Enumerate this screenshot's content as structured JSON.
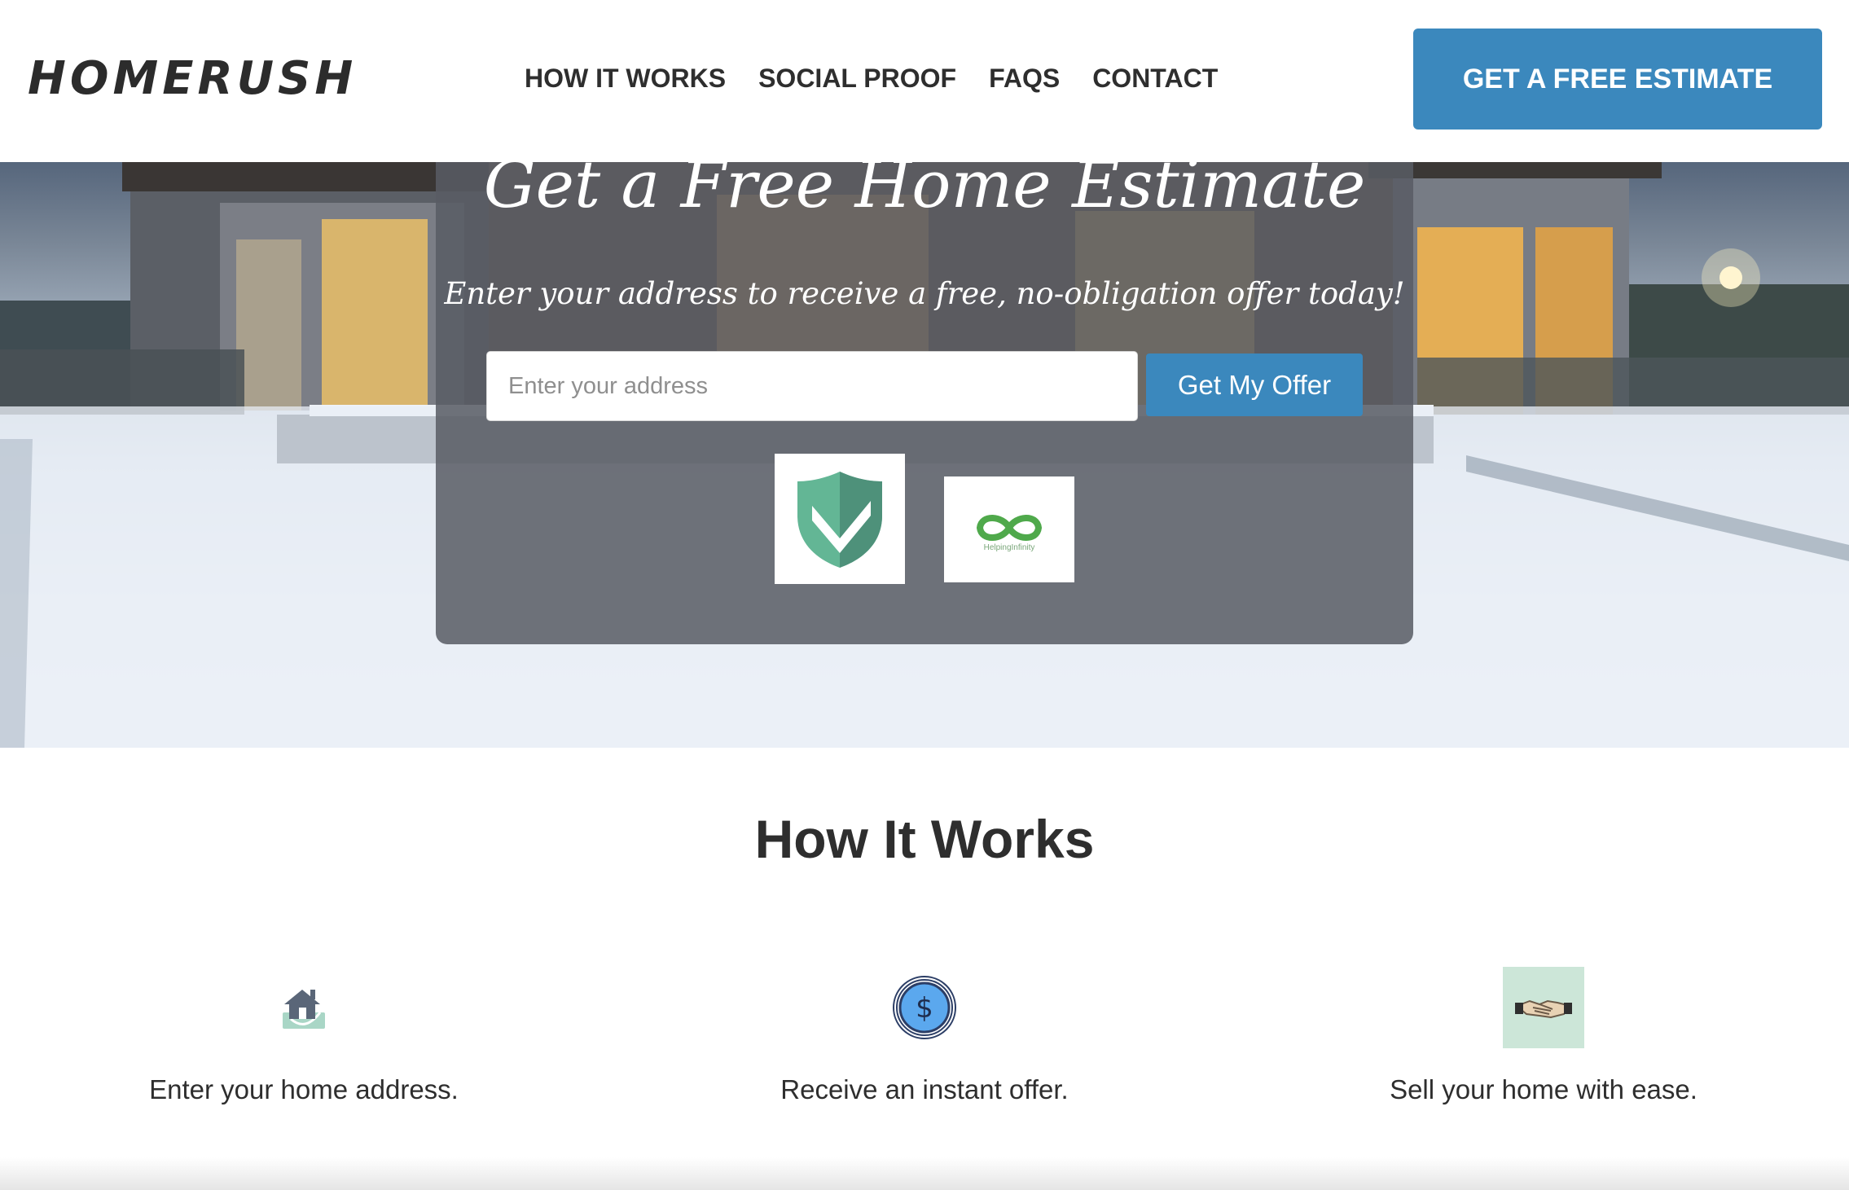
{
  "header": {
    "logo": "HOMERUSH",
    "nav": [
      "HOW IT WORKS",
      "SOCIAL PROOF",
      "FAQS",
      "CONTACT"
    ],
    "cta_label": "GET A FREE ESTIMATE"
  },
  "hero": {
    "title": "Get a Free Home Estimate",
    "subtitle": "Enter your address to receive a free, no-obligation offer today!",
    "address_placeholder": "Enter your address",
    "submit_label": "Get My Offer",
    "badges": {
      "shield_icon": "shield-check-icon",
      "infinity_logo_caption": "HelpingInfinity"
    }
  },
  "how_it_works": {
    "title": "How It Works",
    "steps": [
      {
        "icon": "house-icon",
        "text": "Enter your home address."
      },
      {
        "icon": "dollar-coin-icon",
        "text": "Receive an instant offer."
      },
      {
        "icon": "handshake-icon",
        "text": "Sell your home with ease."
      }
    ]
  },
  "colors": {
    "accent": "#3b88bd",
    "panel": "#585c64",
    "shield_green": "#4e917a",
    "mint": "#cce6d8"
  }
}
